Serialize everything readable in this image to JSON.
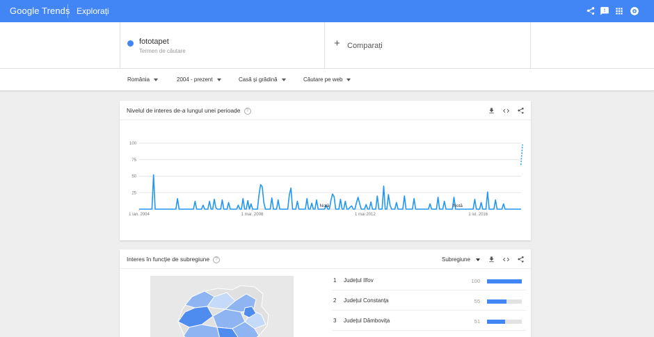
{
  "header": {
    "logo_google": "Google",
    "logo_trends": "Trends",
    "section": "Explorați"
  },
  "term": {
    "name": "fototapet",
    "subtitle": "Termen de căutare",
    "color": "#4285f4"
  },
  "compare": {
    "plus": "+",
    "label": "Comparați"
  },
  "filters": [
    {
      "label": "România"
    },
    {
      "label": "2004 - prezent"
    },
    {
      "label": "Casă și grădină"
    },
    {
      "label": "Căutare pe web"
    }
  ],
  "interest_card": {
    "title": "Nivelul de interes de-a lungul unei perioade",
    "help": "?"
  },
  "chart_data": {
    "type": "line",
    "title": "Nivelul de interes de-a lungul unei perioade",
    "xlabel": "",
    "ylabel": "",
    "y_ticks": [
      "100",
      "75",
      "50",
      "25"
    ],
    "ylim": [
      0,
      100
    ],
    "x_tick_labels": [
      "1 ian. 2004",
      "1 mar. 2008",
      "1 mai 2012",
      "1 iul. 2016"
    ],
    "x_tick_positions": [
      0,
      50,
      100,
      150
    ],
    "x_range": [
      0,
      169
    ],
    "grid": true,
    "annotations": [
      {
        "text": "Notă",
        "x": 82
      },
      {
        "text": "Notă",
        "x": 141
      }
    ],
    "series": [
      {
        "color": "#2196f3",
        "values": [
          0,
          0,
          0,
          0,
          0,
          0,
          0,
          0,
          0,
          52,
          0,
          0,
          0,
          0,
          0,
          0,
          0,
          0,
          0,
          0,
          0,
          0,
          0,
          0,
          16,
          0,
          0,
          0,
          0,
          0,
          0,
          0,
          0,
          0,
          0,
          12,
          0,
          0,
          0,
          0,
          6,
          0,
          0,
          0,
          12,
          0,
          0,
          15,
          2,
          0,
          0,
          0,
          14,
          0,
          0,
          0,
          10,
          0,
          0,
          0,
          0,
          0,
          6,
          0,
          0,
          16,
          0,
          0,
          13,
          0,
          8,
          0,
          0,
          0,
          0,
          22,
          37,
          34,
          10,
          0,
          0,
          0,
          0,
          17,
          0,
          0,
          0,
          14,
          0,
          0,
          0,
          0,
          0,
          0,
          22,
          32,
          0,
          0,
          0,
          12,
          0,
          0,
          0,
          0,
          0,
          16,
          0,
          0,
          9,
          0,
          0,
          14,
          0,
          0,
          0,
          0,
          0,
          6,
          0,
          0,
          13,
          23,
          19,
          0,
          0,
          0,
          15,
          0,
          0,
          12,
          0,
          0,
          3,
          5,
          0,
          0,
          10,
          18,
          8,
          0,
          0,
          0,
          7,
          0,
          0,
          11,
          0,
          0,
          0,
          20,
          0,
          0,
          0,
          35,
          0,
          0,
          22,
          6,
          0,
          0,
          0,
          10,
          0,
          0,
          0,
          0,
          20,
          0,
          0,
          0,
          0,
          0,
          16,
          0,
          0,
          0,
          0,
          0,
          0,
          0,
          0,
          0,
          8,
          0,
          0,
          0,
          0,
          18,
          0,
          0,
          0,
          12,
          0,
          0,
          0,
          0,
          0,
          18,
          0,
          0,
          0,
          0,
          0,
          0,
          0,
          0,
          0,
          0,
          0,
          0,
          15,
          0,
          0,
          0,
          10,
          0,
          0,
          0,
          26,
          0,
          0,
          0,
          0,
          14,
          0,
          0,
          0,
          0,
          8,
          0,
          0,
          0,
          0,
          0,
          0,
          0,
          0,
          0,
          0,
          0
        ],
        "dotted_tail": [
          67,
          98
        ]
      }
    ]
  },
  "subregion_card": {
    "title": "Interes în funcție de subregiune",
    "help": "?",
    "select_label": "Subregiune",
    "rows": [
      {
        "rank": "1",
        "name": "Județul Ilfov",
        "value": "100",
        "level": 100
      },
      {
        "rank": "2",
        "name": "Județul Constanța",
        "value": "55",
        "level": 55
      },
      {
        "rank": "3",
        "name": "Județul Dâmbovița",
        "value": "51",
        "level": 51
      }
    ]
  },
  "colors": {
    "accent": "#4285f4",
    "line": "#2196f3",
    "map_light": "#c5d9f8",
    "map_mid": "#8fb4f2",
    "map_dark": "#4f8cf0",
    "map_base": "#e0e0e0"
  }
}
